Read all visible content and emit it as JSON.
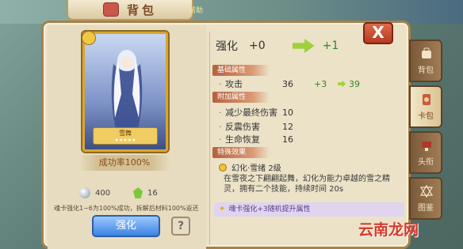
{
  "window": {
    "title": "背包",
    "helper": "帮助"
  },
  "card": {
    "name": "雪舞",
    "stars": "★★★★★",
    "success_rate": "成功率100%"
  },
  "resources": {
    "silver": "400",
    "gem": "16"
  },
  "note": "魂卡强化1~6为100%成功，拆解后材料100%返还",
  "buttons": {
    "strengthen": "强化",
    "help": "?",
    "close": "X"
  },
  "strength": {
    "label": "强化",
    "current": "+0",
    "next": "+1"
  },
  "sections": {
    "base": "基础属性",
    "extra": "附加属性",
    "special": "特殊效果"
  },
  "base_stats": [
    {
      "name": "攻击",
      "value": "36",
      "bonus": "+3",
      "next": "39"
    }
  ],
  "extra_stats": [
    {
      "name": "减少最终伤害",
      "value": "10"
    },
    {
      "name": "反震伤害",
      "value": "12"
    },
    {
      "name": "生命恢复",
      "value": "16"
    }
  ],
  "skill": {
    "name": "幻化·雪绪 2级",
    "desc": "在雪夜之下翩翩起舞，幻化为能力卓越的雪之精灵，拥有二个技能，持续时间 20s"
  },
  "bonus_tip": "魂卡强化+3随机提升属性",
  "side_tabs": [
    {
      "label": "背包",
      "icon": "bag-icon",
      "active": false
    },
    {
      "label": "卡包",
      "icon": "card-pack-icon",
      "active": true
    },
    {
      "label": "头衔",
      "icon": "title-icon",
      "active": false
    },
    {
      "label": "图鉴",
      "icon": "codex-icon",
      "active": false
    }
  ],
  "watermark": "云南龙网",
  "colors": {
    "accent_blue": "#3c83e2",
    "close_red": "#b53a22",
    "up_green": "#2f8a1a",
    "frame_gold": "#d9a532"
  }
}
